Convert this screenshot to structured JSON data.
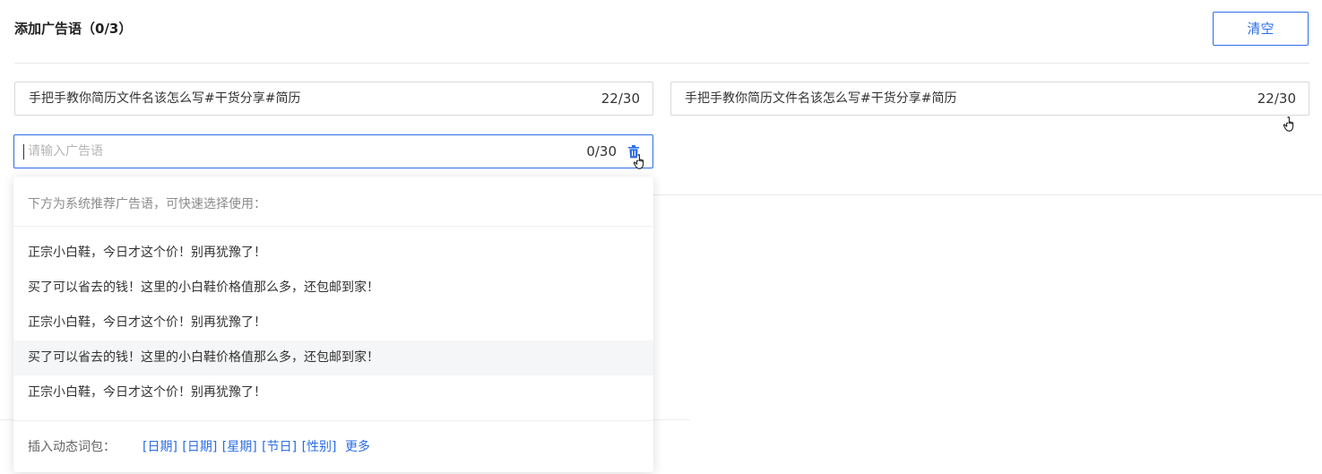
{
  "header": {
    "title": "添加广告语（0/3）",
    "clear_label": "清空"
  },
  "slogans": [
    {
      "text": "手把手教你简历文件名该怎么写#干货分享#简历",
      "counter": "22/30"
    },
    {
      "text": "手把手教你简历文件名该怎么写#干货分享#简历",
      "counter": "22/30"
    }
  ],
  "new_slogan": {
    "value": "",
    "placeholder": "请输入广告语",
    "counter": "0/30"
  },
  "dropdown": {
    "hint": "下方为系统推荐广告语，可快速选择使用：",
    "suggestions": [
      "正宗小白鞋，今日才这个价！别再犹豫了！",
      "买了可以省去的钱！这里的小白鞋价格值那么多，还包邮到家！",
      "正宗小白鞋，今日才这个价！别再犹豫了！",
      "买了可以省去的钱！这里的小白鞋价格值那么多，还包邮到家！",
      "正宗小白鞋，今日才这个价！别再犹豫了！"
    ],
    "hovered_index": 3,
    "insert_label": "插入动态词包：",
    "insert_words": [
      "[日期]",
      "[日期]",
      "[星期]",
      "[节日]",
      "[性别]"
    ],
    "more_label": "更多"
  },
  "colors": {
    "accent": "#2b6de5",
    "border": "#d9d9d9",
    "placeholder": "#b5b5b5",
    "hover_bg": "#f5f6f7"
  },
  "icons": {
    "trash": "trash-icon",
    "cursor": "hand-pointer-icon"
  }
}
